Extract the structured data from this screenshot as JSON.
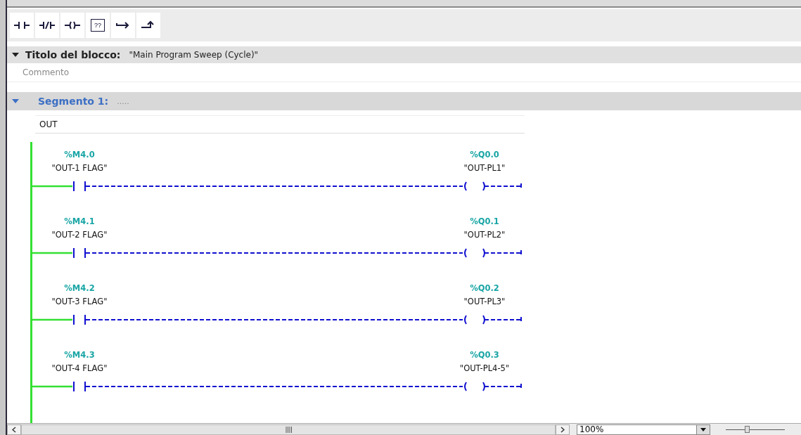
{
  "toolbar": [
    {
      "kind": "no-contact"
    },
    {
      "kind": "nc-contact"
    },
    {
      "kind": "coil"
    },
    {
      "kind": "box",
      "label": "??"
    },
    {
      "kind": "open-branch"
    },
    {
      "kind": "close-branch"
    }
  ],
  "block": {
    "title_label": "Titolo del blocco:",
    "title": "\"Main Program Sweep (Cycle)\"",
    "expanded": true,
    "comment_placeholder": "Commento"
  },
  "segment": {
    "label": "Segmento 1:",
    "title": ".....",
    "expanded": true,
    "comment": "OUT",
    "rungs": [
      {
        "contact_address": "%M4.0",
        "contact_symbol": "\"OUT-1 FLAG\"",
        "coil_address": "%Q0.0",
        "coil_symbol": "\"OUT-PL1\""
      },
      {
        "contact_address": "%M4.1",
        "contact_symbol": "\"OUT-2 FLAG\"",
        "coil_address": "%Q0.1",
        "coil_symbol": "\"OUT-PL2\""
      },
      {
        "contact_address": "%M4.2",
        "contact_symbol": "\"OUT-3 FLAG\"",
        "coil_address": "%Q0.2",
        "coil_symbol": "\"OUT-PL3\""
      },
      {
        "contact_address": "%M4.3",
        "contact_symbol": "\"OUT-4 FLAG\"",
        "coil_address": "%Q0.3",
        "coil_symbol": "\"OUT-PL4-5\""
      }
    ]
  },
  "status_bar": {
    "zoom": "100%",
    "zoom_slider": {
      "level": 0.35
    }
  }
}
